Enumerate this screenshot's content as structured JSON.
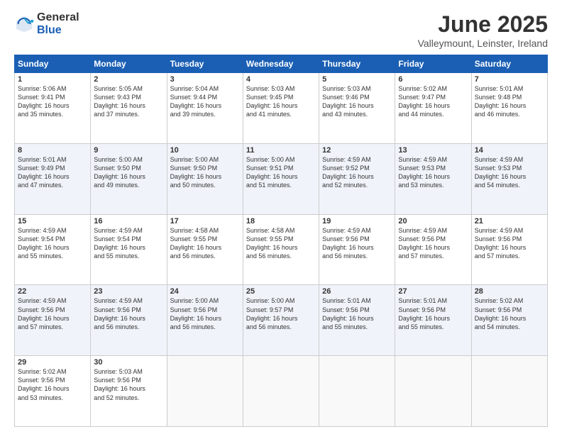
{
  "logo": {
    "general": "General",
    "blue": "Blue"
  },
  "title": "June 2025",
  "location": "Valleymount, Leinster, Ireland",
  "calendar": {
    "headers": [
      "Sunday",
      "Monday",
      "Tuesday",
      "Wednesday",
      "Thursday",
      "Friday",
      "Saturday"
    ],
    "rows": [
      [
        {
          "day": "1",
          "content": "Sunrise: 5:06 AM\nSunset: 9:41 PM\nDaylight: 16 hours\nand 35 minutes."
        },
        {
          "day": "2",
          "content": "Sunrise: 5:05 AM\nSunset: 9:43 PM\nDaylight: 16 hours\nand 37 minutes."
        },
        {
          "day": "3",
          "content": "Sunrise: 5:04 AM\nSunset: 9:44 PM\nDaylight: 16 hours\nand 39 minutes."
        },
        {
          "day": "4",
          "content": "Sunrise: 5:03 AM\nSunset: 9:45 PM\nDaylight: 16 hours\nand 41 minutes."
        },
        {
          "day": "5",
          "content": "Sunrise: 5:03 AM\nSunset: 9:46 PM\nDaylight: 16 hours\nand 43 minutes."
        },
        {
          "day": "6",
          "content": "Sunrise: 5:02 AM\nSunset: 9:47 PM\nDaylight: 16 hours\nand 44 minutes."
        },
        {
          "day": "7",
          "content": "Sunrise: 5:01 AM\nSunset: 9:48 PM\nDaylight: 16 hours\nand 46 minutes."
        }
      ],
      [
        {
          "day": "8",
          "content": "Sunrise: 5:01 AM\nSunset: 9:49 PM\nDaylight: 16 hours\nand 47 minutes."
        },
        {
          "day": "9",
          "content": "Sunrise: 5:00 AM\nSunset: 9:50 PM\nDaylight: 16 hours\nand 49 minutes."
        },
        {
          "day": "10",
          "content": "Sunrise: 5:00 AM\nSunset: 9:50 PM\nDaylight: 16 hours\nand 50 minutes."
        },
        {
          "day": "11",
          "content": "Sunrise: 5:00 AM\nSunset: 9:51 PM\nDaylight: 16 hours\nand 51 minutes."
        },
        {
          "day": "12",
          "content": "Sunrise: 4:59 AM\nSunset: 9:52 PM\nDaylight: 16 hours\nand 52 minutes."
        },
        {
          "day": "13",
          "content": "Sunrise: 4:59 AM\nSunset: 9:53 PM\nDaylight: 16 hours\nand 53 minutes."
        },
        {
          "day": "14",
          "content": "Sunrise: 4:59 AM\nSunset: 9:53 PM\nDaylight: 16 hours\nand 54 minutes."
        }
      ],
      [
        {
          "day": "15",
          "content": "Sunrise: 4:59 AM\nSunset: 9:54 PM\nDaylight: 16 hours\nand 55 minutes."
        },
        {
          "day": "16",
          "content": "Sunrise: 4:59 AM\nSunset: 9:54 PM\nDaylight: 16 hours\nand 55 minutes."
        },
        {
          "day": "17",
          "content": "Sunrise: 4:58 AM\nSunset: 9:55 PM\nDaylight: 16 hours\nand 56 minutes."
        },
        {
          "day": "18",
          "content": "Sunrise: 4:58 AM\nSunset: 9:55 PM\nDaylight: 16 hours\nand 56 minutes."
        },
        {
          "day": "19",
          "content": "Sunrise: 4:59 AM\nSunset: 9:56 PM\nDaylight: 16 hours\nand 56 minutes."
        },
        {
          "day": "20",
          "content": "Sunrise: 4:59 AM\nSunset: 9:56 PM\nDaylight: 16 hours\nand 57 minutes."
        },
        {
          "day": "21",
          "content": "Sunrise: 4:59 AM\nSunset: 9:56 PM\nDaylight: 16 hours\nand 57 minutes."
        }
      ],
      [
        {
          "day": "22",
          "content": "Sunrise: 4:59 AM\nSunset: 9:56 PM\nDaylight: 16 hours\nand 57 minutes."
        },
        {
          "day": "23",
          "content": "Sunrise: 4:59 AM\nSunset: 9:56 PM\nDaylight: 16 hours\nand 56 minutes."
        },
        {
          "day": "24",
          "content": "Sunrise: 5:00 AM\nSunset: 9:56 PM\nDaylight: 16 hours\nand 56 minutes."
        },
        {
          "day": "25",
          "content": "Sunrise: 5:00 AM\nSunset: 9:57 PM\nDaylight: 16 hours\nand 56 minutes."
        },
        {
          "day": "26",
          "content": "Sunrise: 5:01 AM\nSunset: 9:56 PM\nDaylight: 16 hours\nand 55 minutes."
        },
        {
          "day": "27",
          "content": "Sunrise: 5:01 AM\nSunset: 9:56 PM\nDaylight: 16 hours\nand 55 minutes."
        },
        {
          "day": "28",
          "content": "Sunrise: 5:02 AM\nSunset: 9:56 PM\nDaylight: 16 hours\nand 54 minutes."
        }
      ],
      [
        {
          "day": "29",
          "content": "Sunrise: 5:02 AM\nSunset: 9:56 PM\nDaylight: 16 hours\nand 53 minutes."
        },
        {
          "day": "30",
          "content": "Sunrise: 5:03 AM\nSunset: 9:56 PM\nDaylight: 16 hours\nand 52 minutes."
        },
        {
          "day": "",
          "content": ""
        },
        {
          "day": "",
          "content": ""
        },
        {
          "day": "",
          "content": ""
        },
        {
          "day": "",
          "content": ""
        },
        {
          "day": "",
          "content": ""
        }
      ]
    ]
  }
}
